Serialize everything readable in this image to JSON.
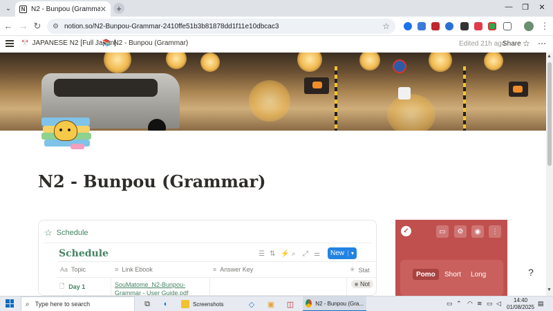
{
  "browser": {
    "tab_title": "N2 - Bunpou (Grammar)",
    "tab_close": "✕",
    "new_tab": "+",
    "window": {
      "minimize": "—",
      "restore": "❐",
      "close": "✕"
    },
    "url": "notion.so/N2-Bunpou-Grammar-2410ffe51b3b81878dd1f11e10dbcac3"
  },
  "notion_topbar": {
    "breadcrumb_parent": "JAPANESE N2 [Full Japan]",
    "breadcrumb_current": "N2 - Bunpou (Grammar)",
    "breadcrumb_separator": "/",
    "edited": "Edited 21h ago",
    "share": "Share"
  },
  "page": {
    "title": "N2 - Bunpou (Grammar)"
  },
  "database": {
    "block_label": "Schedule",
    "view_title": "Schedule",
    "new_button": "New",
    "columns": [
      {
        "icon": "Aa",
        "name": "Topic"
      },
      {
        "icon": "≡",
        "name": "Link Ebook"
      },
      {
        "icon": "≡",
        "name": "Answer Key"
      },
      {
        "icon": "✳",
        "name": "Stat"
      }
    ],
    "rows": [
      {
        "topic": "Day 1",
        "link_ebook": "SouMatome_N2-Bunpou- Grammar - User Guide.pdf",
        "answer_key": "",
        "status": "Not"
      }
    ]
  },
  "pomodoro": {
    "modes": [
      "Pomo",
      "Short",
      "Long"
    ],
    "active_mode": "Pomo",
    "colors": {
      "background": "#c0504e"
    }
  },
  "taskbar": {
    "search_placeholder": "Type here to search",
    "apps": [
      {
        "label": "Screenshots"
      },
      {
        "label": "N2 - Bunpou (Gra..."
      }
    ],
    "time": "14:40",
    "date": "01/08/2025"
  },
  "colors": {
    "notion_green": "#448361",
    "notion_blue": "#2383e2"
  }
}
